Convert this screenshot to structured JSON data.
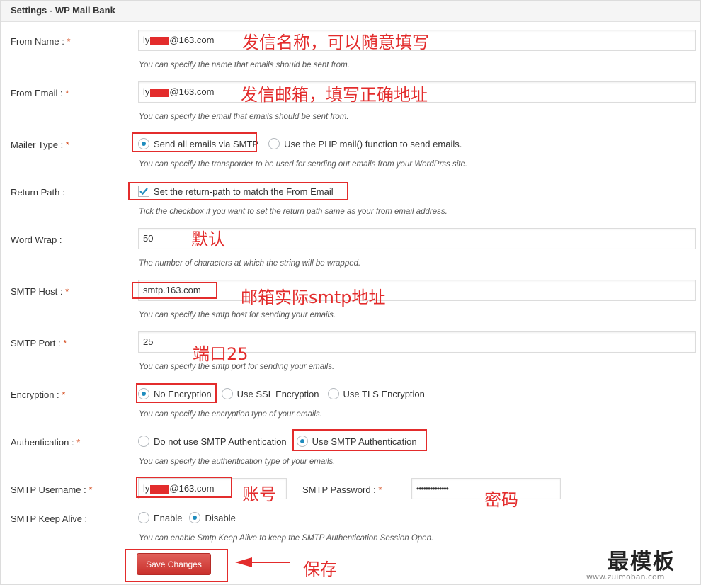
{
  "header": {
    "title": "Settings - WP Mail Bank"
  },
  "fields": {
    "from_name": {
      "label": "From Name :",
      "required": "*",
      "value_prefix": "ly",
      "value_suffix": "@163.com",
      "hint": "You can specify the name that emails should be sent from.",
      "annotation": "发信名称，可以随意填写"
    },
    "from_email": {
      "label": "From Email :",
      "required": "*",
      "value_prefix": "ly",
      "value_suffix": "@163.com",
      "hint": "You can specify the email that emails should be sent from.",
      "annotation": "发信邮箱，填写正确地址"
    },
    "mailer_type": {
      "label": "Mailer Type :",
      "required": "*",
      "options": [
        "Send all emails via SMTP",
        "Use the PHP mail() function to send emails."
      ],
      "selected": 0,
      "hint": "You can specify the transporder to be used for sending out emails from your WordPrss site."
    },
    "return_path": {
      "label": "Return Path :",
      "checkbox_label": "Set the return-path to match the From Email",
      "checked": true,
      "hint": "Tick the checkbox if you want to set the return path same as your from email address."
    },
    "word_wrap": {
      "label": "Word Wrap :",
      "value": "50",
      "hint": "The number of characters at which the string will be wrapped.",
      "annotation": "默认"
    },
    "smtp_host": {
      "label": "SMTP Host :",
      "required": "*",
      "value": "smtp.163.com",
      "hint": "You can specify the smtp host for sending your emails.",
      "annotation": "邮箱实际smtp地址"
    },
    "smtp_port": {
      "label": "SMTP Port :",
      "required": "*",
      "value": "25",
      "hint": "You can specify the smtp port for sending your emails.",
      "annotation": "端口25"
    },
    "encryption": {
      "label": "Encryption :",
      "required": "*",
      "options": [
        "No Encryption",
        "Use SSL Encryption",
        "Use TLS Encryption"
      ],
      "selected": 0,
      "hint": "You can specify the encryption type of your emails."
    },
    "authentication": {
      "label": "Authentication :",
      "required": "*",
      "options": [
        "Do not use SMTP Authentication",
        "Use SMTP Authentication"
      ],
      "selected": 1,
      "hint": "You can specify the authentication type of your emails."
    },
    "smtp_username": {
      "label": "SMTP Username :",
      "required": "*",
      "value_prefix": "ly",
      "value_suffix": "@163.com",
      "annotation": "账号"
    },
    "smtp_password": {
      "label": "SMTP Password :",
      "required": "*",
      "value": "••••••••••••••",
      "annotation": "密码"
    },
    "keep_alive": {
      "label": "SMTP Keep Alive :",
      "options": [
        "Enable",
        "Disable"
      ],
      "selected": 1,
      "hint": "You can enable Smtp Keep Alive to keep the SMTP Authentication Session Open."
    }
  },
  "actions": {
    "save_label": "Save Changes",
    "save_annotation": "保存"
  },
  "watermark": {
    "main": "最模板",
    "sub": "www.zuimoban.com"
  },
  "colors": {
    "annotation_red": "#e32c2c",
    "radio_accent": "#1e8cbe",
    "required_mark": "#d54e21",
    "button_red": "#c9302c"
  }
}
